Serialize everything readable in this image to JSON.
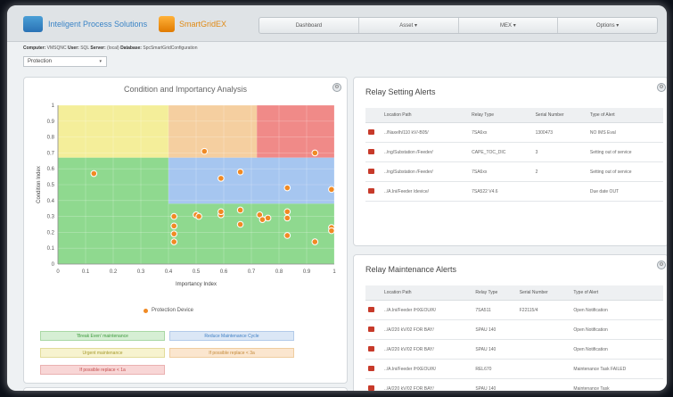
{
  "header": {
    "brand": "Inteligent Process Solutions",
    "product": "SmartGridEX",
    "nav": [
      "Dashboard",
      "Asset ▾",
      "MEX ▾",
      "Options ▾"
    ]
  },
  "info": {
    "computer_label": "Computer:",
    "computer": "VMSQNC",
    "user_label": "User:",
    "user": "SQL",
    "server_label": "Server:",
    "server": "(local)",
    "database_label": "Database:",
    "database": "SpcSmartGridConfiguration"
  },
  "selector": {
    "value": "Protection",
    "caret": "▾"
  },
  "chart_data": {
    "type": "scatter",
    "title": "Condition and Importancy Analysis",
    "xlabel": "Importancy Index",
    "ylabel": "Condition Index",
    "xlim": [
      0,
      1
    ],
    "ylim": [
      0,
      1
    ],
    "xticks": [
      "0",
      "0.1",
      "0.2",
      "0.3",
      "0.4",
      "0.5",
      "0.6",
      "0.7",
      "0.8",
      "0.9",
      "1"
    ],
    "yticks": [
      "0",
      "0.1",
      "0.2",
      "0.3",
      "0.4",
      "0.5",
      "0.6",
      "0.7",
      "0.8",
      "0.9",
      "1"
    ],
    "zones": [
      {
        "x": [
          0,
          0.4
        ],
        "y": [
          0.67,
          1
        ],
        "color": "#f4ee9a"
      },
      {
        "x": [
          0.4,
          0.72
        ],
        "y": [
          0.67,
          1
        ],
        "color": "#f5cfa0"
      },
      {
        "x": [
          0.72,
          1
        ],
        "y": [
          0.67,
          1
        ],
        "color": "#f08a88"
      },
      {
        "x": [
          0,
          0.4
        ],
        "y": [
          0,
          0.67
        ],
        "color": "#8fd98f"
      },
      {
        "x": [
          0.4,
          1
        ],
        "y": [
          0.38,
          0.67
        ],
        "color": "#a6c6f0"
      },
      {
        "x": [
          0.4,
          1
        ],
        "y": [
          0,
          0.38
        ],
        "color": "#8fd98f"
      }
    ],
    "series": [
      {
        "name": "Protection Device",
        "color": "#f08a24",
        "points": [
          [
            0.13,
            0.57
          ],
          [
            0.53,
            0.71
          ],
          [
            0.93,
            0.7
          ],
          [
            0.59,
            0.54
          ],
          [
            0.66,
            0.58
          ],
          [
            0.83,
            0.48
          ],
          [
            0.99,
            0.47
          ],
          [
            0.42,
            0.3
          ],
          [
            0.5,
            0.31
          ],
          [
            0.51,
            0.3
          ],
          [
            0.59,
            0.31
          ],
          [
            0.59,
            0.33
          ],
          [
            0.66,
            0.34
          ],
          [
            0.66,
            0.25
          ],
          [
            0.73,
            0.31
          ],
          [
            0.74,
            0.28
          ],
          [
            0.76,
            0.29
          ],
          [
            0.83,
            0.33
          ],
          [
            0.83,
            0.29
          ],
          [
            0.83,
            0.18
          ],
          [
            0.42,
            0.24
          ],
          [
            0.42,
            0.19
          ],
          [
            0.42,
            0.14
          ],
          [
            0.93,
            0.14
          ],
          [
            0.99,
            0.23
          ],
          [
            0.99,
            0.21
          ]
        ]
      }
    ]
  },
  "legend": {
    "label": "Protection Device"
  },
  "buttons": [
    {
      "label": "'Break Even' maintenance",
      "bg": "#d6efd4",
      "fg": "#3c9a3c",
      "border": "#a9d8a5"
    },
    {
      "label": "Reduce Maintenance Cycle",
      "bg": "#dbe7f6",
      "fg": "#3f7fc4",
      "border": "#b3cbe9"
    },
    {
      "label": "Urgent maintenance",
      "bg": "#f7f3cf",
      "fg": "#a69a2c",
      "border": "#e2dc9a"
    },
    {
      "label": "If possible replace < 3a",
      "bg": "#fbe6cf",
      "fg": "#c48a3a",
      "border": "#efcd9f"
    },
    {
      "label": "If possible replace < 1a",
      "bg": "#f8d6d6",
      "fg": "#c44a4a",
      "border": "#eab1b1"
    }
  ],
  "setting_alerts": {
    "title": "Relay Setting Alerts",
    "columns": [
      "Location Path",
      "Relay Type",
      "Serial Number",
      "Type of Alert"
    ],
    "rows": [
      [
        "../Naxelh/110 kV/-B05/",
        "7SA6xx",
        "1300473",
        "NO IMS Eval"
      ],
      [
        "../ng/Substation /Feeder/",
        "CAPE_TOC_DIC",
        "3",
        "Setting out of service"
      ],
      [
        "../ng/Substation /Feeder/",
        "7SA6xx",
        "2",
        "Setting out of service"
      ],
      [
        "../A.Ini/Feeder /device/",
        "7SA522 V4.6",
        "",
        "Due date OUT"
      ]
    ]
  },
  "maint_alerts": {
    "title": "Relay Maintenance Alerts",
    "columns": [
      "Location Path",
      "Relay Type",
      "Serial Number",
      "Type of Alert"
    ],
    "rows": [
      [
        "../A.Ini/Feeder /HXEOU/K/",
        "7SA511",
        "F22115/4",
        "Open Notification"
      ],
      [
        "../A/220 kV/02 FOR BAY/",
        "SPAU 140",
        "",
        "Open Notification"
      ],
      [
        "../A/220 kV/02 FOR BAY/",
        "SPAU 140",
        "",
        "Open Notification"
      ],
      [
        "../A.Ini/Feeder /HXEOU/K/",
        "REL670",
        "",
        "Maintenance Task FAILED"
      ],
      [
        "../A/220 kV/02 FOR BAY/",
        "SPAU 140",
        "",
        "Maintenance Task"
      ]
    ]
  },
  "icons": {
    "gear": "gear-icon",
    "relay": "relay-icon"
  }
}
